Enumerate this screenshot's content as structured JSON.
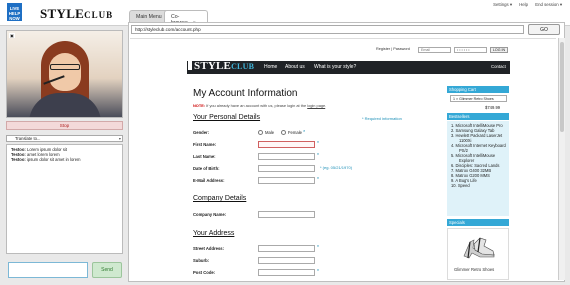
{
  "brand": {
    "badge_lines": [
      "LIVE",
      "HELP",
      "NOW"
    ],
    "name_main": "STYLE",
    "name_sub": "CLUB"
  },
  "top_links": {
    "settings": "Settings ▾",
    "help": "Help",
    "end_session": "End session ▾"
  },
  "tabs": [
    {
      "label": "Main Menu"
    },
    {
      "label": "Co-browse",
      "close": "×"
    }
  ],
  "left_panel": {
    "stop_label": "Stop",
    "translate_label": "Translate to...",
    "chat_lines": [
      {
        "who": "Testoo:",
        "text": "Lorem ipsum dolor sit"
      },
      {
        "who": "Testoo:",
        "text": "amet lorem lorem"
      },
      {
        "who": "Testoo:",
        "text": "ipsum dolor sit amet in lorem"
      }
    ],
    "send_label": "Send"
  },
  "browser": {
    "url": "http://styleclub.com/account.php",
    "go_label": "GO"
  },
  "site": {
    "register_text": "Register | Password",
    "email_placeholder": "Email",
    "password_placeholder": "• • • • • •",
    "login_label": "LOG IN",
    "logo_main": "STYLE",
    "logo_sub": "CLUB",
    "nav": [
      "Home",
      "About us",
      "What is your style?"
    ],
    "nav_contact": "Contact",
    "page_title": "My Account Information",
    "note_label": "NOTE:",
    "note_text": "If you already have an account with us, please login at the",
    "note_link": "login page",
    "required_note": "* Required information",
    "sections": {
      "personal": "Your Personal Details",
      "company": "Company Details",
      "address": "Your Address"
    },
    "fields": {
      "gender": "Gender:",
      "male": "Male",
      "female": "Female",
      "first_name": "First Name:",
      "last_name": "Last Name:",
      "dob": "Date of Birth:",
      "dob_hint": "* (eg. 05/21/1970)",
      "email": "E-Mail Address:",
      "company_name": "Company Name:",
      "street": "Street Address:",
      "suburb": "Suburb:",
      "post_code": "Post Code:"
    },
    "star": "*",
    "shopping_cart": {
      "title": "Shopping Cart",
      "selected_item": "1 × Glimmer Retro Shoes",
      "total": "$749.99"
    },
    "bestsellers": {
      "title": "Bestsellers",
      "items": [
        "1. Microsoft IntelliMouse Pro",
        "2. Samsung Galaxy Tab",
        "3. Hewlett Packard LaserJet 1100Xi",
        "4. Microsoft Internet Keyboard PS/2",
        "5. Microsoft IntelliMouse Explorer",
        "6. Disciples: Sacred Lands",
        "7. Matrox G400 32MB",
        "8. Matrox G200 MMS",
        "9. A Bug's Life",
        "10. Speed"
      ]
    },
    "specials": {
      "title": "Specials",
      "product": "Glimmer Retro Shoes"
    }
  }
}
